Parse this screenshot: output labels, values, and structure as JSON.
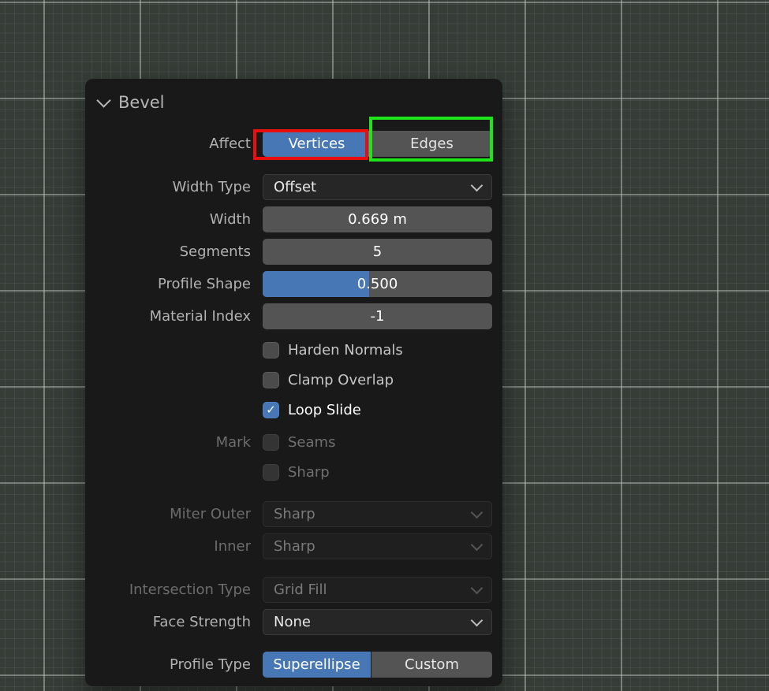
{
  "viewport": {
    "background_color": "#363d37",
    "grid_minor_color": "#444b44",
    "grid_major_color": "#6d726c"
  },
  "colors": {
    "accent_blue": "#4877b6",
    "annotation_red": "#ea0e0e",
    "annotation_green": "#1ee419",
    "panel_background": "#191919",
    "field_gray": "#545454"
  },
  "icons": {
    "checkmark": "✓",
    "chevron_down": "v"
  },
  "panel": {
    "title": "Bevel",
    "affect": {
      "label": "Affect",
      "vertices": "Vertices",
      "edges": "Edges",
      "selected": "Vertices"
    },
    "width_type": {
      "label": "Width Type",
      "value": "Offset"
    },
    "width": {
      "label": "Width",
      "value": "0.669 m"
    },
    "segments": {
      "label": "Segments",
      "value": "5"
    },
    "profile_shape": {
      "label": "Profile Shape",
      "value": "0.500",
      "fill_style": "width:46.4%"
    },
    "material_index": {
      "label": "Material Index",
      "value": "-1"
    },
    "harden_normals": {
      "label": "Harden Normals",
      "checked": false
    },
    "clamp_overlap": {
      "label": "Clamp Overlap",
      "checked": false
    },
    "loop_slide": {
      "label": "Loop Slide",
      "checked": true
    },
    "mark": {
      "label": "Mark"
    },
    "seams": {
      "label": "Seams",
      "checked": false,
      "disabled": true
    },
    "sharp": {
      "label": "Sharp",
      "checked": false,
      "disabled": true
    },
    "miter_outer": {
      "label": "Miter Outer",
      "value": "Sharp",
      "disabled": true
    },
    "inner": {
      "label": "Inner",
      "value": "Sharp",
      "disabled": true
    },
    "intersection_type": {
      "label": "Intersection Type",
      "value": "Grid Fill",
      "disabled": true
    },
    "face_strength": {
      "label": "Face Strength",
      "value": "None"
    },
    "profile_type": {
      "label": "Profile Type",
      "superellipse": "Superellipse",
      "custom": "Custom",
      "selected": "Superellipse"
    }
  }
}
